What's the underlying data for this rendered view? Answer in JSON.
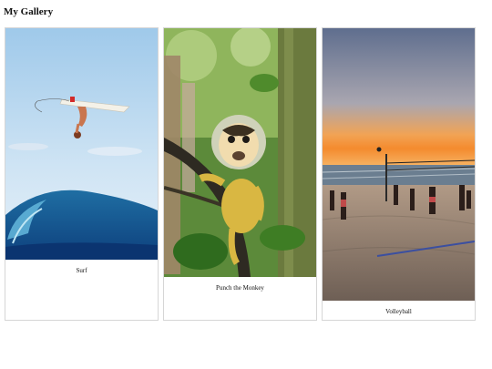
{
  "page": {
    "title": "My Gallery"
  },
  "gallery": {
    "items": [
      {
        "caption": "Surf",
        "image": "surfer-jumping-over-wave"
      },
      {
        "caption": "Punch the Monkey",
        "image": "squirrel-monkey-on-branch"
      },
      {
        "caption": "Volleyball",
        "image": "beach-volleyball-at-sunset"
      }
    ]
  }
}
